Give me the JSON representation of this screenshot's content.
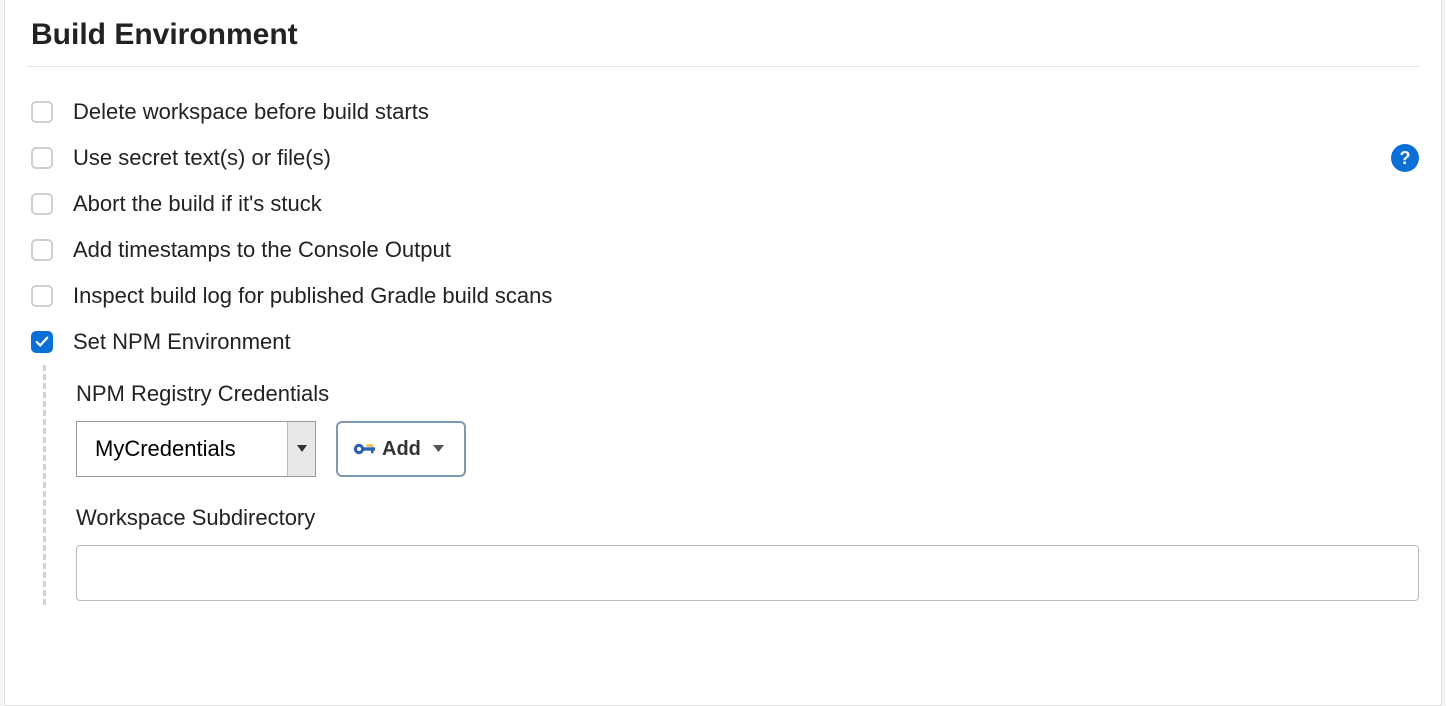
{
  "section": {
    "title": "Build Environment"
  },
  "options": {
    "delete_workspace": {
      "label": "Delete workspace before build starts",
      "checked": false
    },
    "use_secret": {
      "label": "Use secret text(s) or file(s)",
      "checked": false,
      "has_help": true
    },
    "abort_stuck": {
      "label": "Abort the build if it's stuck",
      "checked": false
    },
    "add_timestamps": {
      "label": "Add timestamps to the Console Output",
      "checked": false
    },
    "inspect_gradle": {
      "label": "Inspect build log for published Gradle build scans",
      "checked": false
    },
    "set_npm_env": {
      "label": "Set NPM Environment",
      "checked": true
    }
  },
  "npm_env": {
    "credentials_label": "NPM Registry Credentials",
    "credentials_value": "MyCredentials",
    "add_button_label": "Add",
    "workspace_subdir_label": "Workspace Subdirectory",
    "workspace_subdir_value": ""
  },
  "help_glyph": "?"
}
